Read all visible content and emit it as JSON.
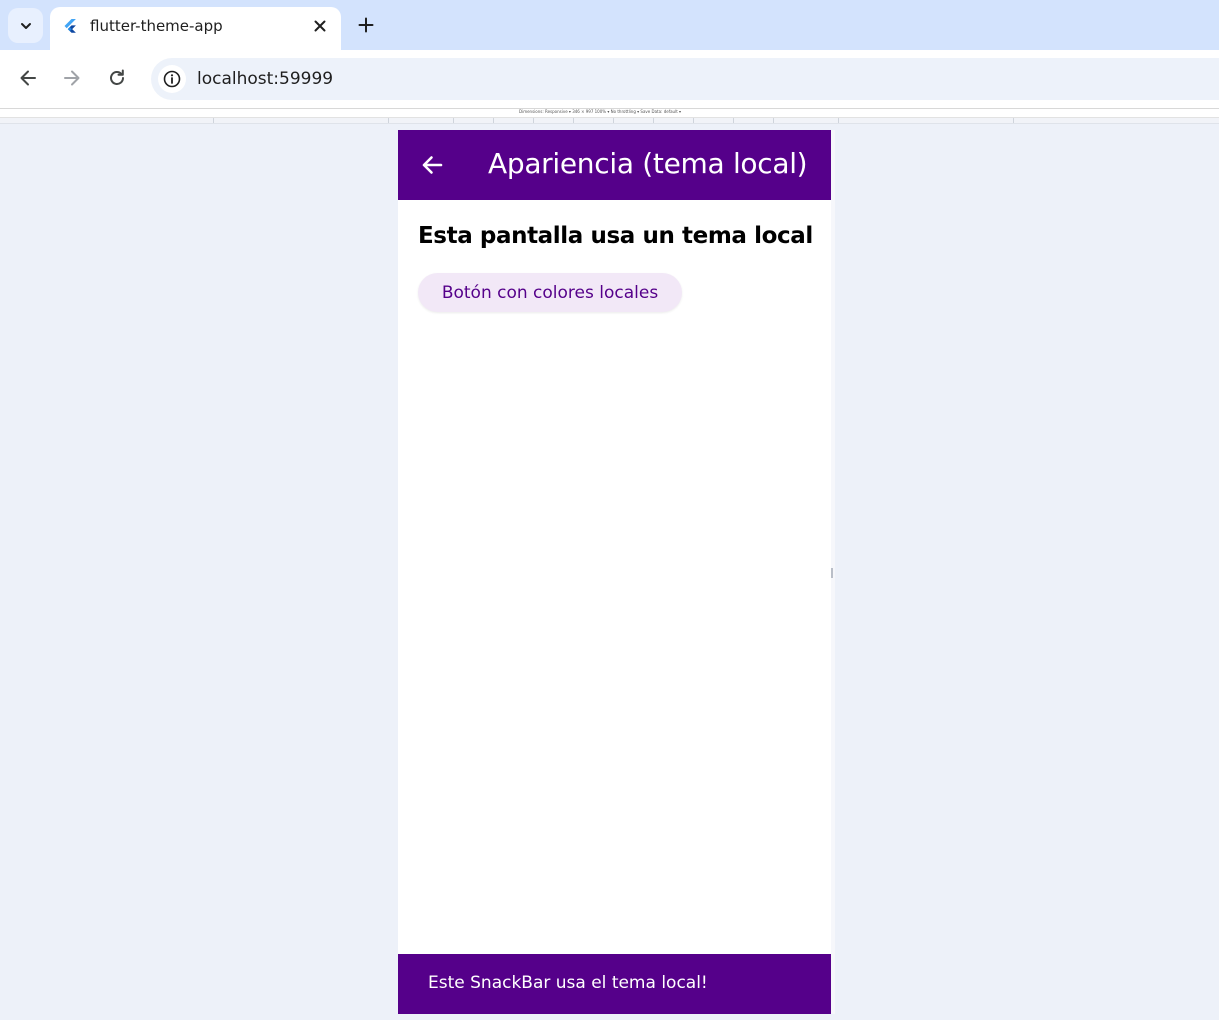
{
  "browser": {
    "tab": {
      "title": "flutter-theme-app",
      "favicon": "flutter-icon"
    },
    "address_bar": {
      "url": "localhost:59999",
      "site_info_icon": "info-icon"
    },
    "devtools_bar": {
      "text": "Dimensions: Responsive ▾   346  ×  997    100% ▾   No throttling ▾   Save Data: default ▾"
    }
  },
  "app": {
    "appbar": {
      "title": "Apariencia (tema local)",
      "back_icon": "arrow-back-icon"
    },
    "heading": "Esta pantalla usa un tema local",
    "button_label": "Botón con colores locales",
    "snackbar_text": "Este SnackBar usa el tema local!"
  },
  "colors": {
    "primary": "#55008a",
    "button_background": "#f2e8f7",
    "on_primary": "#ffffff",
    "browser_tabstrip": "#d3e3fd",
    "page_background": "#edf1f9"
  }
}
